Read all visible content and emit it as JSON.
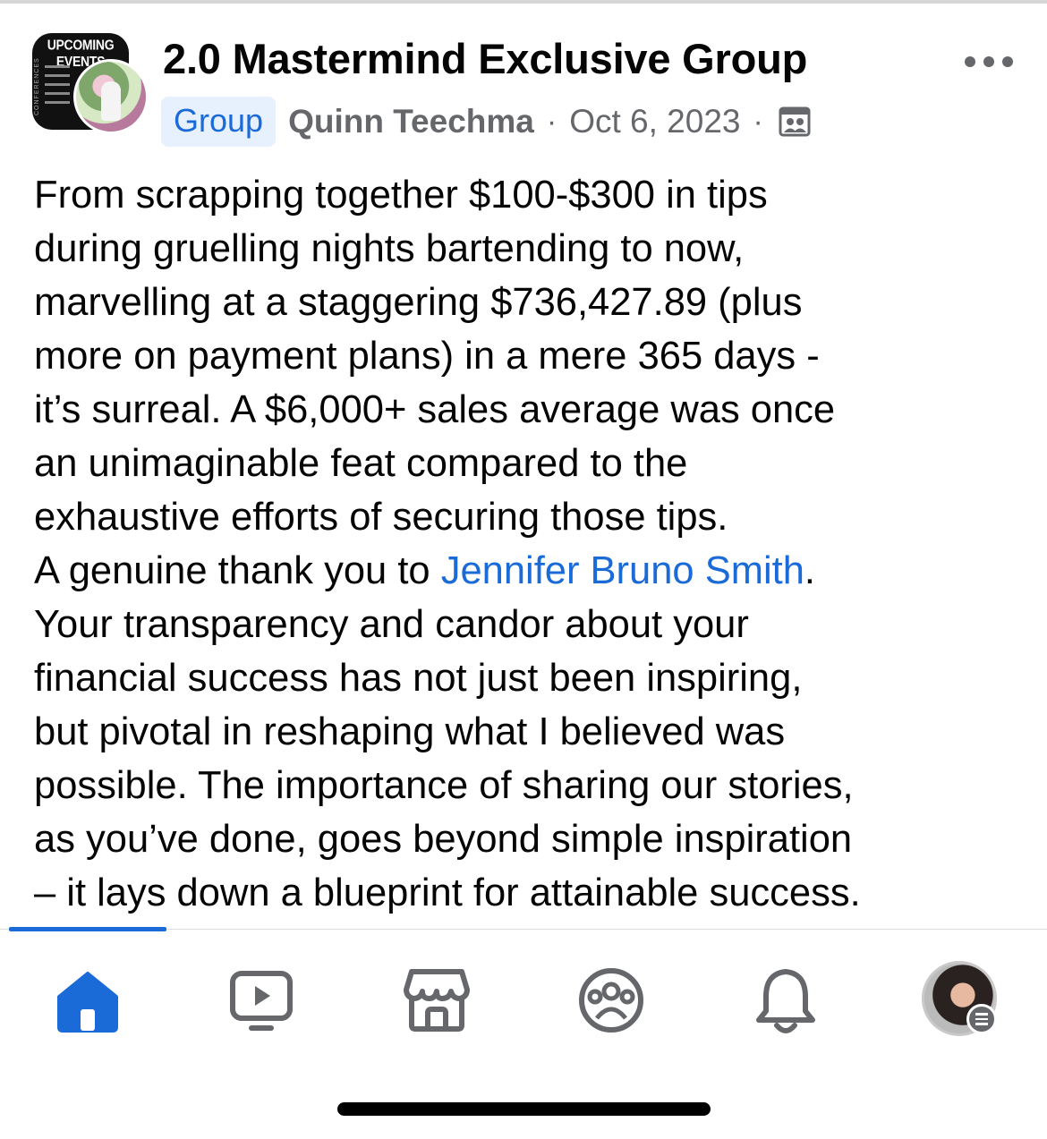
{
  "post_header": {
    "group_name": "2.0 Mastermind Exclusive Group",
    "group_avatar_banner": "UPCOMING EVENTS",
    "group_avatar_side_text": "CONFERENCES",
    "group_chip": "Group",
    "author": "Quinn Teechma",
    "separator": "·",
    "date": "Oct 6, 2023",
    "privacy_icon": "members-group-icon",
    "more_icon": "more-horizontal-icon"
  },
  "post_body": {
    "lines": [
      "From scrapping together $100-$300 in tips",
      "during gruelling nights bartending to now,",
      "marvelling at a staggering $736,427.89 (plus",
      "more on payment plans) in a mere 365 days -",
      "it’s surreal. A $6,000+ sales average was once",
      "an unimaginable feat compared to the",
      "exhaustive efforts of securing those tips."
    ],
    "thank_prefix": "A genuine thank you to ",
    "mention": "Jennifer Bruno Smith",
    "thank_suffix": ".",
    "lines_after": [
      "Your transparency and candor about your",
      "financial success has not just been inspiring,",
      "but pivotal in reshaping what I believed was",
      "possible. The importance of sharing our stories,",
      "as you’ve done, goes beyond simple inspiration",
      "– it lays down a blueprint for attainable success."
    ]
  },
  "tab_bar": {
    "tabs": [
      {
        "name": "home",
        "icon": "home-icon",
        "active": true
      },
      {
        "name": "video",
        "icon": "video-icon",
        "active": false
      },
      {
        "name": "marketplace",
        "icon": "marketplace-icon",
        "active": false
      },
      {
        "name": "groups",
        "icon": "groups-icon",
        "active": false
      },
      {
        "name": "notifications",
        "icon": "bell-icon",
        "active": false
      },
      {
        "name": "profile-menu",
        "icon": "menu-icon",
        "active": false
      }
    ],
    "active_color": "#1a6bd8",
    "inactive_color": "#65676b"
  }
}
